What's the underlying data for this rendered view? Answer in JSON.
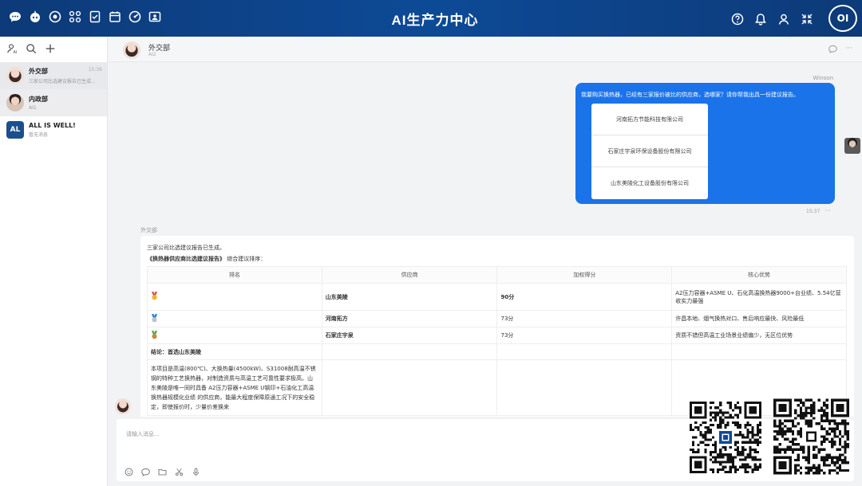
{
  "app": {
    "title": "AI生产力中心",
    "logo_text": "OI"
  },
  "topbar": {
    "left_icons": [
      "chat-bubble-icon",
      "robot-icon",
      "settings-cog-icon",
      "apps-grid-icon",
      "document-check-icon",
      "calendar-icon",
      "dashboard-icon",
      "contact-card-icon"
    ],
    "right_icons": [
      "help-icon",
      "bell-icon",
      "user-icon",
      "collapse-icon"
    ]
  },
  "sidebar": {
    "tools": [
      "contacts-icon",
      "search-icon",
      "plus-icon"
    ],
    "conversations": [
      {
        "name": "外交部",
        "preview": "三家公司比选建议报告已生成...",
        "time": "15:36",
        "avatar": "girl"
      },
      {
        "name": "内政部",
        "preview": "AI1",
        "time": "",
        "avatar": "boy"
      },
      {
        "name": "ALL IS WELL!",
        "preview": "暂无消息",
        "time": "",
        "avatar": "AL"
      }
    ]
  },
  "chat_header": {
    "name": "外交部",
    "sub": "AI2"
  },
  "messages": {
    "user": {
      "sender": "Winson",
      "text": "我要购买换热器，已经有三家报价被比的供应商，选哪家？请你帮我出具一份建议报告。",
      "options": [
        "河南拓方节能科技有限公司",
        "石家庄宇泉环保设备股份有限公司",
        "山东美陵化工设备股份有限公司"
      ],
      "time": "15:37",
      "more": "···"
    },
    "bot": {
      "sender": "外交部",
      "line1": "三家公司比选建议报告已生成。",
      "line2_title": "《换热器供应商比选建议报告》",
      "line2_rest": " 综合建议排序：",
      "table": {
        "headers": [
          "排名",
          "供应商",
          "加权得分",
          "核心优势"
        ],
        "rows": [
          {
            "supplier": "山东美陵",
            "score": "90分",
            "advantage": "A2压力容器+ASME U、石化高温换热器9000+台业绩、5.54亿营收实力最强"
          },
          {
            "supplier": "河南拓方",
            "score": "73分",
            "advantage": "许昌本地、烟气换热对口、售后响应最快、风险最低"
          },
          {
            "supplier": "石家庄宇泉",
            "score": "73分",
            "advantage": "资质不错但高温工业场景业绩偏少，无区位优势"
          }
        ],
        "conclusion": "结论：首选山东美陵",
        "summary": "本项目是高温(800℃)、大换热量(4500kW)、S31008耐高温不锈钢的特种工艺换热器，对制造资质与高温工艺可靠性要求极高。山东美陵是唯一同时具备 A2压力容器+ASME U钢印+石油化工高温换热器规模化业绩 的供应商，能最大程度保障原通工况下的安全稳定，即使报价时，少量价差换来"
      }
    }
  },
  "input": {
    "placeholder": "请输入消息..."
  },
  "colors": {
    "topbar": "#0d4a96",
    "bubble": "#1a73e8"
  }
}
